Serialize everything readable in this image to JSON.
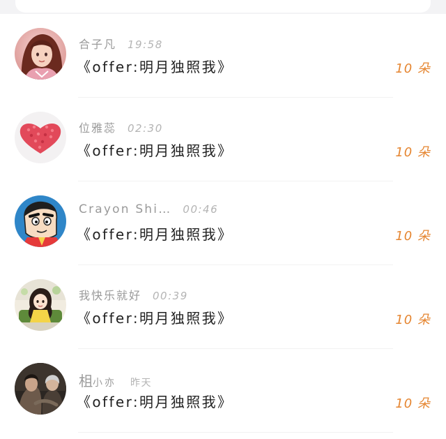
{
  "items": [
    {
      "name": "合子凡",
      "time": "19:58",
      "message": "《offer:明月独照我》",
      "count": "10 朵",
      "avatar_icon": "anime-girl-avatar"
    },
    {
      "name": "位雅蕊",
      "time": "02:30",
      "message": "《offer:明月独照我》",
      "count": "10 朵",
      "avatar_icon": "red-heart-avatar"
    },
    {
      "name": "Crayon Shi…",
      "time": "00:46",
      "message": "《offer:明月独照我》",
      "count": "10 朵",
      "avatar_icon": "cartoon-boy-avatar"
    },
    {
      "name": "我快乐就好",
      "time": "00:39",
      "message": "《offer:明月独照我》",
      "count": "10 朵",
      "avatar_icon": "cartoon-girl-avatar"
    },
    {
      "name_main": "柤",
      "name_rest": "小亦",
      "time": "昨天",
      "message": "《offer:明月独照我》",
      "count": "10 朵",
      "avatar_icon": "couple-photo-avatar"
    }
  ],
  "colors": {
    "accent": "#e58530",
    "name": "#9a9a9a",
    "time": "#b4b4b4",
    "message": "#222222"
  }
}
